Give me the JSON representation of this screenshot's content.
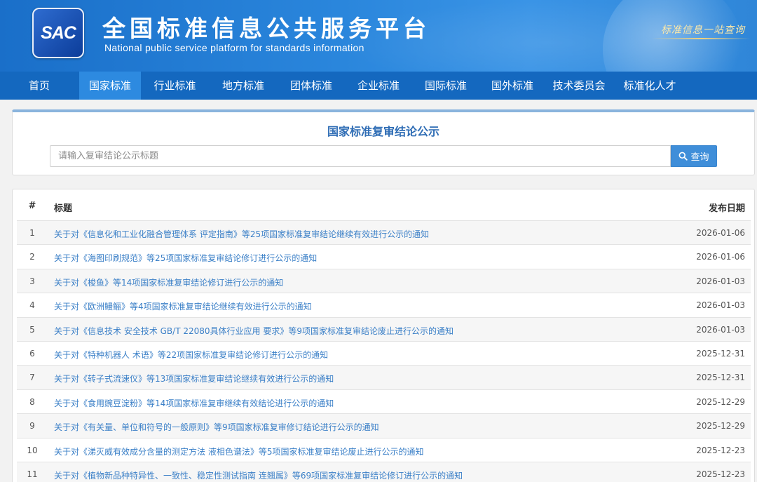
{
  "header": {
    "logo_text": "SAC",
    "title_cn": "全国标准信息公共服务平台",
    "title_en": "National public service platform  for standards information",
    "slogan": "标准信息一站查询"
  },
  "nav": {
    "active_index": 1,
    "items": [
      {
        "label": "首页"
      },
      {
        "label": "国家标准"
      },
      {
        "label": "行业标准"
      },
      {
        "label": "地方标准"
      },
      {
        "label": "团体标准"
      },
      {
        "label": "企业标准"
      },
      {
        "label": "国际标准"
      },
      {
        "label": "国外标准"
      },
      {
        "label": "技术委员会"
      },
      {
        "label": "标准化人才"
      }
    ]
  },
  "search": {
    "title": "国家标准复审结论公示",
    "placeholder": "请输入复审结论公示标题",
    "value": "",
    "button_label": "查询"
  },
  "table": {
    "headers": {
      "index": "#",
      "title": "标题",
      "date": "发布日期"
    },
    "rows": [
      {
        "index": "1",
        "title": "关于对《信息化和工业化融合管理体系 评定指南》等25项国家标准复审结论继续有效进行公示的通知",
        "date": "2026-01-06"
      },
      {
        "index": "2",
        "title": "关于对《海图印刷规范》等25项国家标准复审结论修订进行公示的通知",
        "date": "2026-01-06"
      },
      {
        "index": "3",
        "title": "关于对《梭鱼》等14项国家标准复审结论修订进行公示的通知",
        "date": "2026-01-03"
      },
      {
        "index": "4",
        "title": "关于对《欧洲鳗鲡》等4项国家标准复审结论继续有效进行公示的通知",
        "date": "2026-01-03"
      },
      {
        "index": "5",
        "title": "关于对《信息技术 安全技术 GB/T 22080具体行业应用 要求》等9项国家标准复审结论废止进行公示的通知",
        "date": "2026-01-03"
      },
      {
        "index": "6",
        "title": "关于对《特种机器人 术语》等22项国家标准复审结论修订进行公示的通知",
        "date": "2025-12-31"
      },
      {
        "index": "7",
        "title": "关于对《转子式流速仪》等13项国家标准复审结论继续有效进行公示的通知",
        "date": "2025-12-31"
      },
      {
        "index": "8",
        "title": "关于对《食用豌豆淀粉》等14项国家标准复审继续有效结论进行公示的通知",
        "date": "2025-12-29"
      },
      {
        "index": "9",
        "title": "关于对《有关量、单位和符号的一般原则》等9项国家标准复审修订结论进行公示的通知",
        "date": "2025-12-29"
      },
      {
        "index": "10",
        "title": "关于对《涕灭威有效成分含量的测定方法 液相色谱法》等5项国家标准复审结论废止进行公示的通知",
        "date": "2025-12-23"
      },
      {
        "index": "11",
        "title": "关于对《植物新品种特异性、一致性、稳定性测试指南 连翘属》等69项国家标准复审结论修订进行公示的通知",
        "date": "2025-12-23"
      }
    ]
  }
}
